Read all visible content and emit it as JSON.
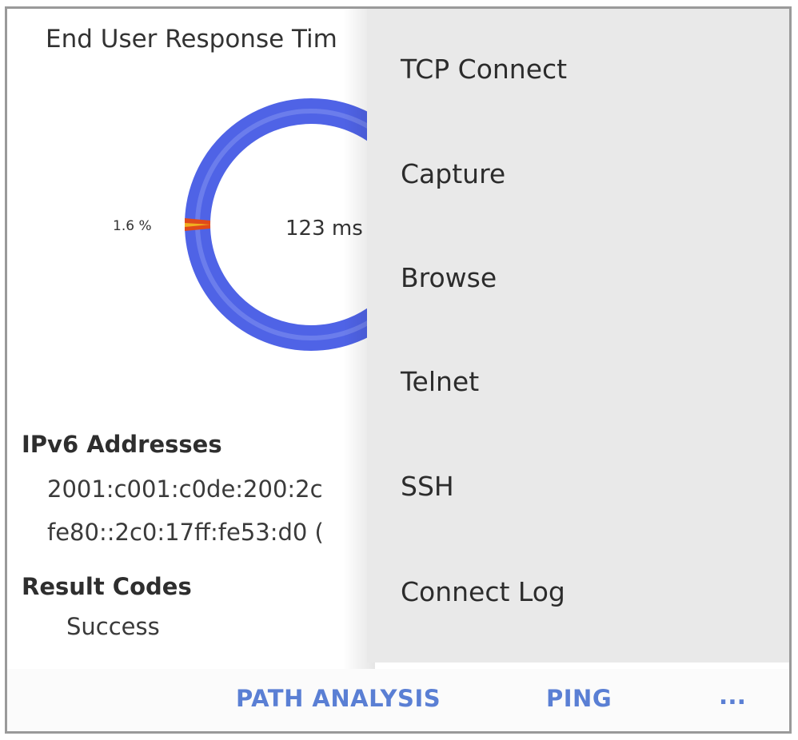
{
  "chart": {
    "title": "End User Response Tim",
    "center_label": "123 ms",
    "pct_label": "1.6 %",
    "colors": {
      "main": "#4f63e6",
      "highlight": "#7f8ff0",
      "error": "#e04a1a",
      "accent": "#f0b020"
    }
  },
  "chart_data": {
    "type": "pie",
    "title": "End User Response Tim",
    "slices": [
      {
        "label": "1.6 %",
        "value": 1.6,
        "color": "#e04a1a"
      },
      {
        "label": "",
        "value": 98.4,
        "color": "#4f63e6"
      }
    ],
    "center_text": "123 ms"
  },
  "ipv6": {
    "heading": "IPv6 Addresses",
    "addresses": [
      "2001:c001:c0de:200:2c",
      "fe80::2c0:17ff:fe53:d0 ("
    ]
  },
  "result_codes": {
    "heading": "Result Codes",
    "value": "Success"
  },
  "bottom_bar": {
    "path_analysis": "PATH ANALYSIS",
    "ping": "PING",
    "overflow": "..."
  },
  "menu": {
    "items": [
      {
        "label": "TCP Connect"
      },
      {
        "label": "Capture"
      },
      {
        "label": "Browse"
      },
      {
        "label": "Telnet"
      },
      {
        "label": "SSH"
      },
      {
        "label": "Connect Log"
      }
    ]
  }
}
